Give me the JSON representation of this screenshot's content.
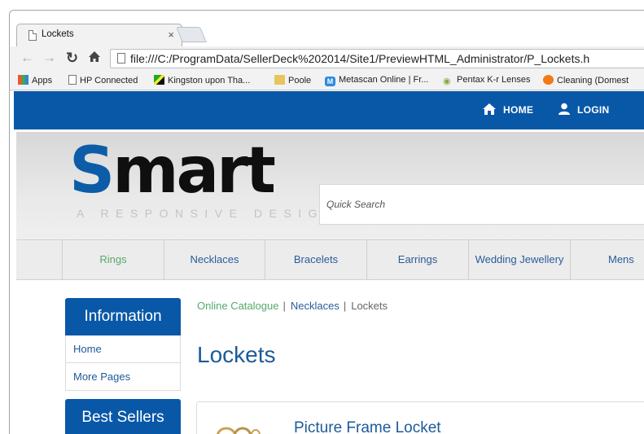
{
  "browser": {
    "tab_title": "Lockets",
    "tab_close": "×",
    "url": "file:///C:/ProgramData/SellerDeck%202014/Site1/PreviewHTML_Administrator/P_Lockets.h",
    "bookmarks": [
      {
        "label": "Apps",
        "icon": "apps-grid-icon"
      },
      {
        "label": "HP Connected",
        "icon": "page-icon"
      },
      {
        "label": "Kingston upon Tha...",
        "icon": "flag-icon"
      },
      {
        "label": "Poole",
        "icon": "folder-icon"
      },
      {
        "label": "Metascan Online | Fr...",
        "icon": "metascan-icon"
      },
      {
        "label": "Pentax K-r Lenses",
        "icon": "eye-icon"
      },
      {
        "label": "Cleaning (Domest",
        "icon": "check-icon"
      }
    ]
  },
  "site": {
    "topnav": {
      "home": "HOME",
      "login": "LOGIN"
    },
    "logo": {
      "s": "S",
      "mart": "mart",
      "tagline": "A RESPONSIVE DESIGN"
    },
    "search_placeholder": "Quick Search",
    "categories": [
      "Rings",
      "Necklaces",
      "Bracelets",
      "Earrings",
      "Wedding Jewellery",
      "Mens"
    ],
    "sidebar": {
      "information": {
        "title": "Information",
        "items": [
          "Home",
          "More Pages"
        ]
      },
      "best_sellers": {
        "title": "Best Sellers"
      }
    },
    "breadcrumb": {
      "catalogue": "Online Catalogue",
      "sep1": "|",
      "necklaces": "Necklaces",
      "sep2": "|",
      "current": "Lockets"
    },
    "page_title": "Lockets",
    "product": {
      "name": "Picture Frame Locket"
    }
  },
  "colors": {
    "brand_blue": "#0958a8",
    "active_green": "#58a86a",
    "link_blue": "#1d5a98"
  }
}
